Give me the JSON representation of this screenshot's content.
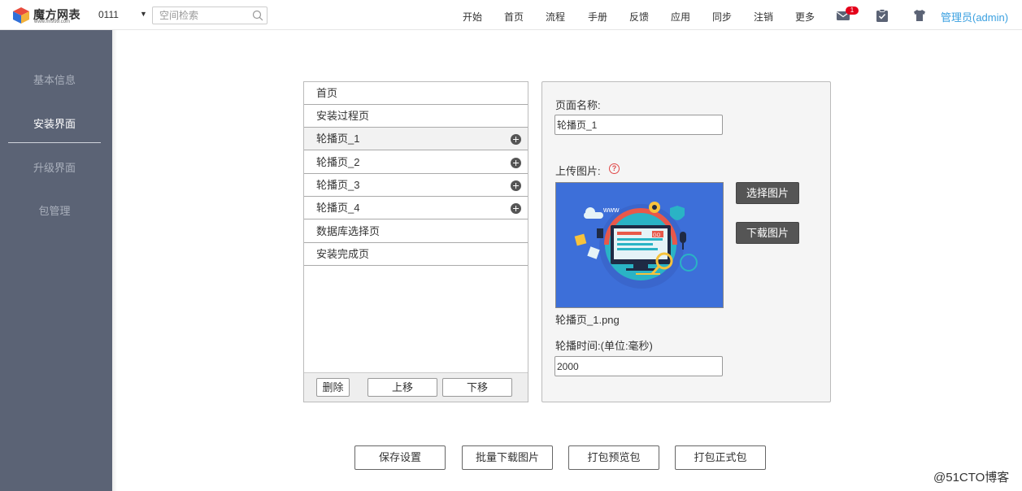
{
  "header": {
    "logo_title": "魔方网表",
    "logo_sub": "www.mf999.com",
    "project": "0111",
    "search_placeholder": "空间检索",
    "nav": [
      "开始",
      "首页",
      "流程",
      "手册",
      "反馈",
      "应用",
      "同步",
      "注销",
      "更多"
    ],
    "mail_badge": "1",
    "user": "管理员(admin)"
  },
  "sidebar": {
    "items": [
      {
        "label": "基本信息",
        "active": false
      },
      {
        "label": "安装界面",
        "active": true
      },
      {
        "label": "升级界面",
        "active": false
      },
      {
        "label": "包管理",
        "active": false
      }
    ]
  },
  "pages": {
    "rows": [
      {
        "label": "首页",
        "selected": false,
        "add": false
      },
      {
        "label": "安装过程页",
        "selected": false,
        "add": false
      },
      {
        "label": "轮播页_1",
        "selected": true,
        "add": true
      },
      {
        "label": "轮播页_2",
        "selected": false,
        "add": true
      },
      {
        "label": "轮播页_3",
        "selected": false,
        "add": true
      },
      {
        "label": "轮播页_4",
        "selected": false,
        "add": true
      },
      {
        "label": "数据库选择页",
        "selected": false,
        "add": false
      },
      {
        "label": "安装完成页",
        "selected": false,
        "add": false
      }
    ],
    "delete_label": "删除",
    "up_label": "上移",
    "down_label": "下移"
  },
  "detail": {
    "page_name_label": "页面名称:",
    "page_name_value": "轮播页_1",
    "upload_label": "上传图片:",
    "help_symbol": "?",
    "select_image_label": "选择图片",
    "download_image_label": "下载图片",
    "image_filename": "轮播页_1.png",
    "image_text_www": "www",
    "image_text_go": "GO",
    "carousel_time_label": "轮播时间:(单位:毫秒)",
    "carousel_time_value": "2000"
  },
  "actions": {
    "save": "保存设置",
    "batch_download": "批量下载图片",
    "pack_preview": "打包预览包",
    "pack_release": "打包正式包"
  },
  "watermark": "@51CTO博客",
  "colors": {
    "sidebar_bg": "#5b6375",
    "user_link": "#3aa0e0",
    "badge": "#e4001a",
    "preview_bg": "#3d6fd9"
  }
}
